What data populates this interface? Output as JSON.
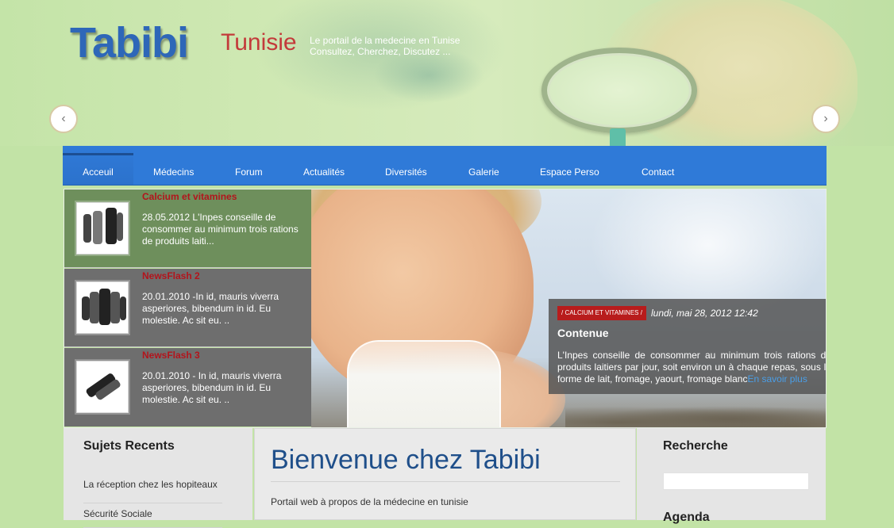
{
  "header": {
    "logo_main": "Tabibi",
    "logo_sub": "Tunisie",
    "tagline_line1": "Le portail de la medecine en Tunise",
    "tagline_line2": "Consultez, Cherchez, Discutez ..."
  },
  "nav": {
    "items": [
      {
        "label": "Acceuil",
        "active": true
      },
      {
        "label": "Médecins"
      },
      {
        "label": "Forum"
      },
      {
        "label": "Actualités"
      },
      {
        "label": "Diversités"
      },
      {
        "label": "Galerie"
      },
      {
        "label": "Espace Perso"
      },
      {
        "label": "Contact"
      }
    ]
  },
  "slider": {
    "news": [
      {
        "title": "Calcium et vitamines",
        "text": "28.05.2012 L'Inpes conseille de consommer au minimum trois rations de produits laiti..."
      },
      {
        "title": "NewsFlash 2",
        "text": "20.01.2010 -In id, mauris viverra asperiores, bibendum in id. Eu molestie. Ac sit eu. .."
      },
      {
        "title": "NewsFlash 3",
        "text": "20.01.2010 - In id, mauris viverra asperiores, bibendum in id. Eu molestie. Ac sit eu. .."
      }
    ],
    "caption": {
      "tag": "/ CALCIUM ET VITAMINES /",
      "date": "lundi, mai 28, 2012 12:42",
      "title": "Contenue",
      "text": "L'Inpes conseille de consommer au minimum trois rations de produits laitiers par jour, soit environ un à chaque repas, sous la forme de lait, fromage, yaourt, fromage blanc",
      "more": "En savoir plus"
    },
    "prev_icon": "chevron-left-icon",
    "next_icon": "chevron-right-icon"
  },
  "left_col": {
    "title": "Sujets Recents",
    "items": [
      "La réception chez les hopiteaux",
      "Sécurité Sociale"
    ]
  },
  "main": {
    "title": "Bienvenue chez Tabibi",
    "text": "Portail web à propos de la médecine en tunisie"
  },
  "right_col": {
    "title": "Recherche",
    "search_placeholder": "",
    "next_title": "Agenda"
  },
  "colors": {
    "background": "#c2e3a6",
    "nav": "#2f7ad8",
    "logo_blue": "#2e67b8",
    "logo_red": "#c33a3a",
    "news_title": "#b3141c",
    "heading_blue": "#1f4f8a"
  }
}
